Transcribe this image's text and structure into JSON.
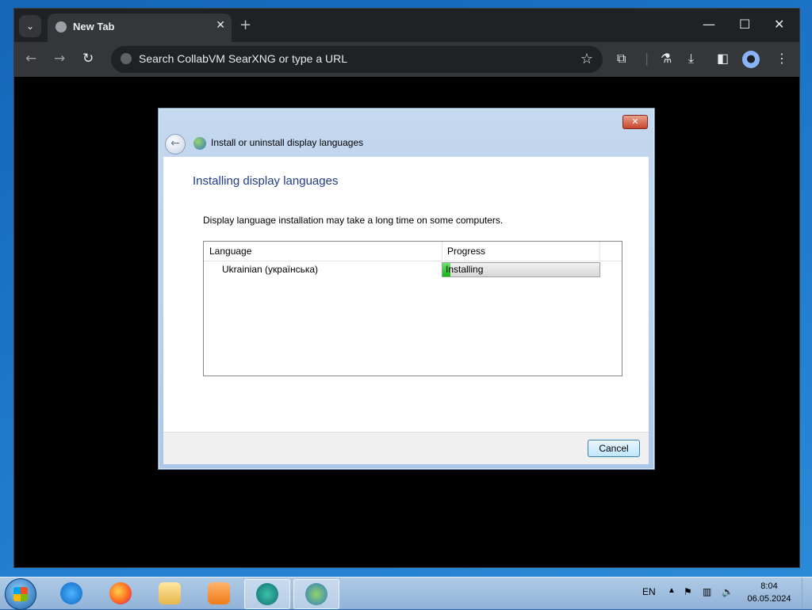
{
  "browser": {
    "tab_title": "New Tab",
    "omnibox_placeholder": "Search CollabVM SearXNG or type a URL"
  },
  "dialog": {
    "window_title": "Install or uninstall display languages",
    "heading": "Installing display languages",
    "description": "Display language installation may take a long time on some computers.",
    "columns": [
      "Language",
      "Progress"
    ],
    "rows": [
      {
        "language": "Ukrainian (українська)",
        "status": "Installing",
        "progress": 0.05
      }
    ],
    "cancel_label": "Cancel"
  },
  "taskbar": {
    "language": "EN",
    "time": "8:04",
    "date": "06.05.2024",
    "pinned": [
      "internet-explorer",
      "firefox",
      "file-explorer",
      "media-player",
      "chrome",
      "language-installer"
    ]
  },
  "colors": {
    "dialog_heading": "#1f3c88",
    "progress_fill": "#14b514"
  }
}
